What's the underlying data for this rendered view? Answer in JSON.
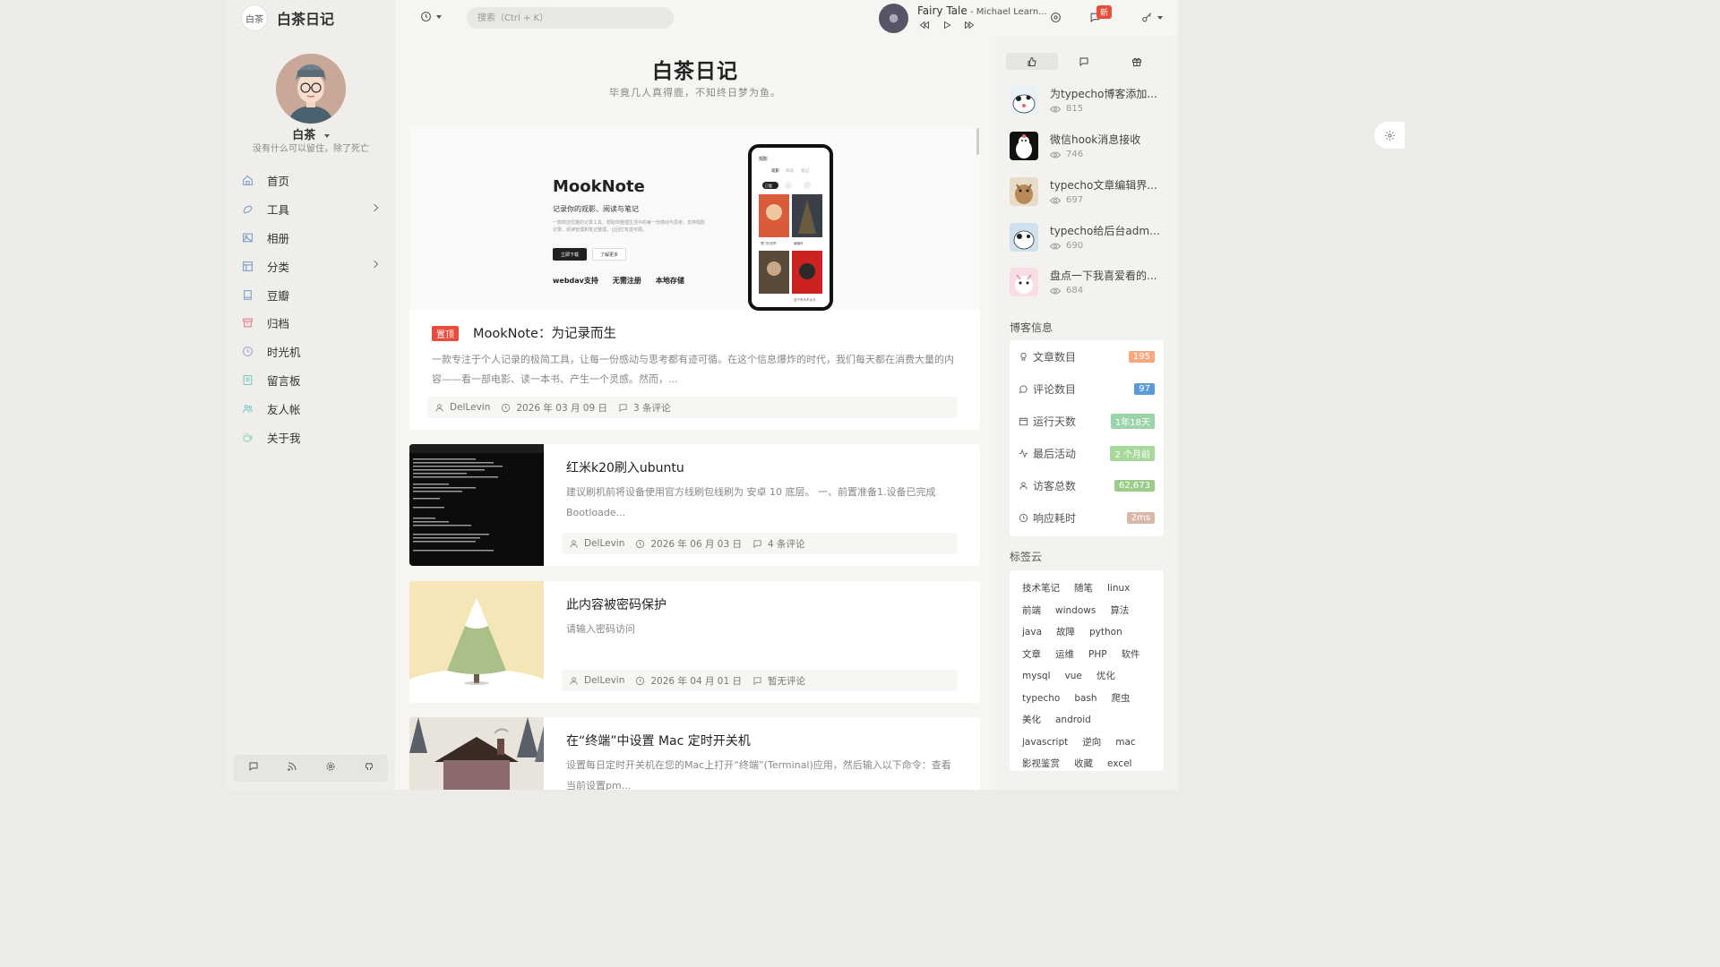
{
  "brand": {
    "name": "白茶日记",
    "logo_text": "白茶"
  },
  "profile": {
    "name": "白茶",
    "motto": "没有什么可以留住，除了死亡"
  },
  "nav": [
    {
      "label": "首页",
      "icon": "home-icon",
      "has_children": false
    },
    {
      "label": "工具",
      "icon": "wrench-icon",
      "has_children": true
    },
    {
      "label": "相册",
      "icon": "image-icon",
      "has_children": false
    },
    {
      "label": "分类",
      "icon": "layout-icon",
      "has_children": true
    },
    {
      "label": "豆瓣",
      "icon": "book-icon",
      "has_children": false
    },
    {
      "label": "归档",
      "icon": "archive-icon",
      "has_children": false
    },
    {
      "label": "时光机",
      "icon": "clock-icon",
      "has_children": false
    },
    {
      "label": "留言板",
      "icon": "message-board-icon",
      "has_children": false
    },
    {
      "label": "友人帐",
      "icon": "users-icon",
      "has_children": false
    },
    {
      "label": "关于我",
      "icon": "coffee-icon",
      "has_children": false
    }
  ],
  "header": {
    "search_placeholder": "搜索（Ctrl + K）",
    "song_title": "Fairy Tale",
    "song_artist": " - Michael Learn...",
    "badge_new": "新"
  },
  "main": {
    "title": "白茶日记",
    "subtitle": "毕竟几人真得鹿，不知终日梦为鱼。",
    "featured": {
      "pin_label": "置顶",
      "title": "MookNote：为记录而生",
      "excerpt": "一款专注于个人记录的极简工具，让每一份感动与思考都有迹可循。在这个信息爆炸的时代，我们每天都在消费大量的内容——看一部电影、读一本书、产生一个灵感。然而，...",
      "author": "DelLevin",
      "date": "2026 年 03 月 09 日",
      "comments": "3 条评论",
      "banner": {
        "title": "MookNote",
        "tagline": "记录你的观影、阅读与笔记",
        "desc": "一款简洁优雅的记录工具，帮助你整理生活中的每一份感动与思考。支持观影记录、阅读管理和笔记整理，让回忆有迹可循。",
        "btn_primary": "立即下载",
        "btn_secondary": "了解更多",
        "features": [
          "webdav支持",
          "无需注册",
          "本地存储"
        ],
        "phone_header": "观影",
        "phone_tabs": [
          "观影",
          "阅读",
          "笔记"
        ],
        "phone_filter": "已看",
        "phone_captions": [
          "楚门的世界",
          "蝙蝠侠",
          "",
          "这个杀手不太冷"
        ]
      }
    },
    "posts": [
      {
        "title": "红米k20刷入ubuntu",
        "excerpt": "建议刷机前将设备使用官方线刷包线刷为 安卓 10 底层。 一、前置准备1.设备已完成 Bootloade...",
        "author": "DelLevin",
        "date": "2026 年 06 月 03 日",
        "comments": "4 条评论"
      },
      {
        "title": "此内容被密码保护",
        "excerpt": "请输入密码访问",
        "author": "DelLevin",
        "date": "2026 年 04 月 01 日",
        "comments": "暂无评论"
      },
      {
        "title": "在“终端”中设置 Mac 定时开关机",
        "excerpt": "设置每日定时开关机在您的Mac上打开“终端”(Terminal)应用，然后输入以下命令：查看当前设置pm..."
      }
    ]
  },
  "right": {
    "hot": [
      {
        "title": "为typecho博客添加...",
        "views": "815"
      },
      {
        "title": "微信hook消息接收",
        "views": "746"
      },
      {
        "title": "typecho文章编辑界...",
        "views": "697"
      },
      {
        "title": "typecho给后台admi...",
        "views": "690"
      },
      {
        "title": "盘点一下我喜爱看的...",
        "views": "684"
      }
    ],
    "stats_heading": "博客信息",
    "stats": [
      {
        "label": "文章数目",
        "value": "195",
        "color": "#f5a97f",
        "icon": "bulb-icon"
      },
      {
        "label": "评论数目",
        "value": "97",
        "color": "#5b9bd5",
        "icon": "comment-icon"
      },
      {
        "label": "运行天数",
        "value": "1年18天",
        "color": "#9bd4a8",
        "icon": "calendar-icon"
      },
      {
        "label": "最后活动",
        "value": "2 个月前",
        "color": "#a8d89c",
        "icon": "activity-icon"
      },
      {
        "label": "访客总数",
        "value": "62,673",
        "color": "#9ccc8a",
        "icon": "user-icon"
      },
      {
        "label": "响应耗时",
        "value": "2ms",
        "color": "#d9b8a8",
        "icon": "timer-icon"
      }
    ],
    "tags_heading": "标签云",
    "tags": [
      "技术笔记",
      "随笔",
      "linux",
      "前端",
      "windows",
      "算法",
      "java",
      "故障",
      "python",
      "文章",
      "运维",
      "PHP",
      "软件",
      "mysql",
      "vue",
      "优化",
      "typecho",
      "bash",
      "爬虫",
      "美化",
      "android",
      "javascript",
      "逆向",
      "mac",
      "影视鉴赏",
      "收藏",
      "excel"
    ]
  }
}
